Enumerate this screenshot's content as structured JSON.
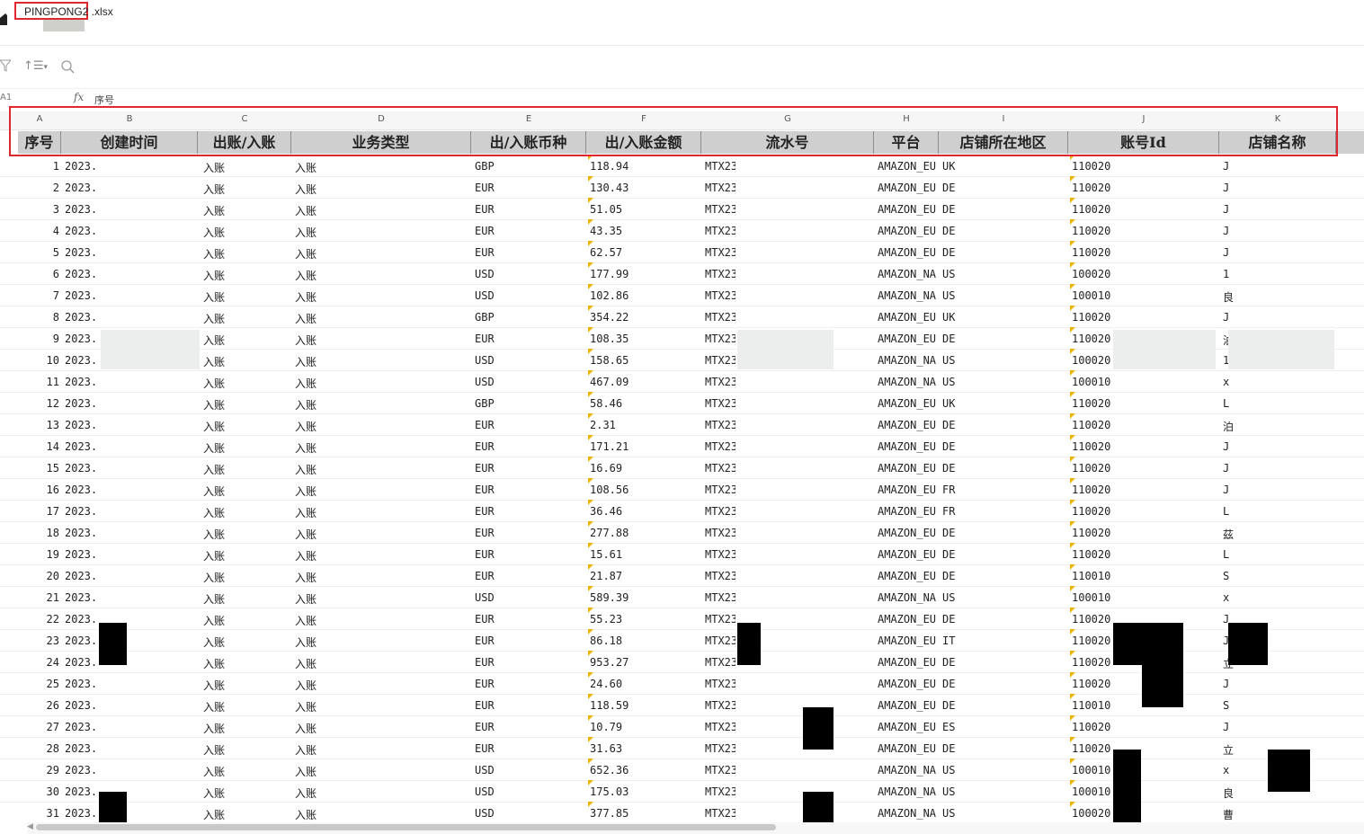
{
  "file": {
    "name_part1": "PINGPONG",
    "name_part2": "2 .xlsx"
  },
  "toolbar": {
    "filter_icon": "filter-icon",
    "sort_icon": "sort-icon",
    "search_icon": "search-icon",
    "sort_glyph": "↑☰",
    "chevron": "▾"
  },
  "formula_bar": {
    "cell_ref": "A1",
    "fx": "fx",
    "value": "序号"
  },
  "columns": {
    "letters": [
      "A",
      "B",
      "C",
      "D",
      "E",
      "F",
      "G",
      "H",
      "I",
      "J",
      "K"
    ],
    "headers": [
      "序号",
      "创建时间",
      "出账/入账",
      "业务类型",
      "出/入账币种",
      "出/入账金额",
      "流水号",
      "平台",
      "店铺所在地区",
      "账号Id",
      "店铺名称"
    ]
  },
  "rows": [
    {
      "n": "1",
      "date": "2023.(",
      "dir": "入账",
      "type": "入账",
      "cur": "GBP",
      "amt": "118.94",
      "serial": "MTX23",
      "plat": "AMAZON_EU",
      "region": "UK",
      "acct": "110020",
      "shop": "J"
    },
    {
      "n": "2",
      "date": "2023.(",
      "dir": "入账",
      "type": "入账",
      "cur": "EUR",
      "amt": "130.43",
      "serial": "MTX23",
      "plat": "AMAZON_EU",
      "region": "DE",
      "acct": "110020",
      "shop": "J"
    },
    {
      "n": "3",
      "date": "2023.(",
      "dir": "入账",
      "type": "入账",
      "cur": "EUR",
      "amt": "51.05",
      "serial": "MTX23",
      "plat": "AMAZON_EU",
      "region": "DE",
      "acct": "110020",
      "shop": "J"
    },
    {
      "n": "4",
      "date": "2023.(",
      "dir": "入账",
      "type": "入账",
      "cur": "EUR",
      "amt": "43.35",
      "serial": "MTX23",
      "plat": "AMAZON_EU",
      "region": "DE",
      "acct": "110020",
      "shop": "J"
    },
    {
      "n": "5",
      "date": "2023.(",
      "dir": "入账",
      "type": "入账",
      "cur": "EUR",
      "amt": "62.57",
      "serial": "MTX23",
      "plat": "AMAZON_EU",
      "region": "DE",
      "acct": "110020",
      "shop": "J"
    },
    {
      "n": "6",
      "date": "2023.(",
      "dir": "入账",
      "type": "入账",
      "cur": "USD",
      "amt": "177.99",
      "serial": "MTX23",
      "plat": "AMAZON_NA",
      "region": "US",
      "acct": "100020",
      "shop": "1"
    },
    {
      "n": "7",
      "date": "2023.(",
      "dir": "入账",
      "type": "入账",
      "cur": "USD",
      "amt": "102.86",
      "serial": "MTX23",
      "plat": "AMAZON_NA",
      "region": "US",
      "acct": "100010",
      "shop": "良"
    },
    {
      "n": "8",
      "date": "2023.(",
      "dir": "入账",
      "type": "入账",
      "cur": "GBP",
      "amt": "354.22",
      "serial": "MTX23",
      "plat": "AMAZON_EU",
      "region": "UK",
      "acct": "110020",
      "shop": "J"
    },
    {
      "n": "9",
      "date": "2023.(",
      "dir": "入账",
      "type": "入账",
      "cur": "EUR",
      "amt": "108.35",
      "serial": "MTX23",
      "plat": "AMAZON_EU",
      "region": "DE",
      "acct": "110020",
      "shop": "泊"
    },
    {
      "n": "10",
      "date": "2023.(",
      "dir": "入账",
      "type": "入账",
      "cur": "USD",
      "amt": "158.65",
      "serial": "MTX23",
      "plat": "AMAZON_NA",
      "region": "US",
      "acct": "100020",
      "shop": "1"
    },
    {
      "n": "11",
      "date": "2023.(",
      "dir": "入账",
      "type": "入账",
      "cur": "USD",
      "amt": "467.09",
      "serial": "MTX23",
      "plat": "AMAZON_NA",
      "region": "US",
      "acct": "100010",
      "shop": "x"
    },
    {
      "n": "12",
      "date": "2023.(",
      "dir": "入账",
      "type": "入账",
      "cur": "GBP",
      "amt": "58.46",
      "serial": "MTX23",
      "plat": "AMAZON_EU",
      "region": "UK",
      "acct": "110020",
      "shop": "L"
    },
    {
      "n": "13",
      "date": "2023.(",
      "dir": "入账",
      "type": "入账",
      "cur": "EUR",
      "amt": "2.31",
      "serial": "MTX23",
      "plat": "AMAZON_EU",
      "region": "DE",
      "acct": "110020",
      "shop": "泊"
    },
    {
      "n": "14",
      "date": "2023.(",
      "dir": "入账",
      "type": "入账",
      "cur": "EUR",
      "amt": "171.21",
      "serial": "MTX23",
      "plat": "AMAZON_EU",
      "region": "DE",
      "acct": "110020",
      "shop": "J"
    },
    {
      "n": "15",
      "date": "2023.(",
      "dir": "入账",
      "type": "入账",
      "cur": "EUR",
      "amt": "16.69",
      "serial": "MTX23",
      "plat": "AMAZON_EU",
      "region": "DE",
      "acct": "110020",
      "shop": "J"
    },
    {
      "n": "16",
      "date": "2023.(",
      "dir": "入账",
      "type": "入账",
      "cur": "EUR",
      "amt": "108.56",
      "serial": "MTX23",
      "plat": "AMAZON_EU",
      "region": "FR",
      "acct": "110020",
      "shop": "J"
    },
    {
      "n": "17",
      "date": "2023.(",
      "dir": "入账",
      "type": "入账",
      "cur": "EUR",
      "amt": "36.46",
      "serial": "MTX23",
      "plat": "AMAZON_EU",
      "region": "FR",
      "acct": "110020",
      "shop": "L"
    },
    {
      "n": "18",
      "date": "2023.(",
      "dir": "入账",
      "type": "入账",
      "cur": "EUR",
      "amt": "277.88",
      "serial": "MTX23",
      "plat": "AMAZON_EU",
      "region": "DE",
      "acct": "110020",
      "shop": "茲"
    },
    {
      "n": "19",
      "date": "2023.(",
      "dir": "入账",
      "type": "入账",
      "cur": "EUR",
      "amt": "15.61",
      "serial": "MTX23",
      "plat": "AMAZON_EU",
      "region": "DE",
      "acct": "110020",
      "shop": "L"
    },
    {
      "n": "20",
      "date": "2023.(",
      "dir": "入账",
      "type": "入账",
      "cur": "EUR",
      "amt": "21.87",
      "serial": "MTX23",
      "plat": "AMAZON_EU",
      "region": "DE",
      "acct": "110010",
      "shop": "S"
    },
    {
      "n": "21",
      "date": "2023.(",
      "dir": "入账",
      "type": "入账",
      "cur": "USD",
      "amt": "589.39",
      "serial": "MTX23",
      "plat": "AMAZON_NA",
      "region": "US",
      "acct": "100010",
      "shop": "x"
    },
    {
      "n": "22",
      "date": "2023.(",
      "dir": "入账",
      "type": "入账",
      "cur": "EUR",
      "amt": "55.23",
      "serial": "MTX23",
      "plat": "AMAZON_EU",
      "region": "DE",
      "acct": "110020",
      "shop": "J"
    },
    {
      "n": "23",
      "date": "2023.(",
      "dir": "入账",
      "type": "入账",
      "cur": "EUR",
      "amt": "86.18",
      "serial": "MTX23",
      "plat": "AMAZON_EU",
      "region": "IT",
      "acct": "110020",
      "shop": "J"
    },
    {
      "n": "24",
      "date": "2023.(",
      "dir": "入账",
      "type": "入账",
      "cur": "EUR",
      "amt": "953.27",
      "serial": "MTX23",
      "plat": "AMAZON_EU",
      "region": "DE",
      "acct": "110020",
      "shop": "立"
    },
    {
      "n": "25",
      "date": "2023.(",
      "dir": "入账",
      "type": "入账",
      "cur": "EUR",
      "amt": "24.60",
      "serial": "MTX23",
      "plat": "AMAZON_EU",
      "region": "DE",
      "acct": "110020",
      "shop": "J"
    },
    {
      "n": "26",
      "date": "2023.(",
      "dir": "入账",
      "type": "入账",
      "cur": "EUR",
      "amt": "118.59",
      "serial": "MTX23",
      "plat": "AMAZON_EU",
      "region": "DE",
      "acct": "110010",
      "shop": "S"
    },
    {
      "n": "27",
      "date": "2023.(",
      "dir": "入账",
      "type": "入账",
      "cur": "EUR",
      "amt": "10.79",
      "serial": "MTX23",
      "plat": "AMAZON_EU",
      "region": "ES",
      "acct": "110020",
      "shop": "J"
    },
    {
      "n": "28",
      "date": "2023.(",
      "dir": "入账",
      "type": "入账",
      "cur": "EUR",
      "amt": "31.63",
      "serial": "MTX23",
      "plat": "AMAZON_EU",
      "region": "DE",
      "acct": "110020",
      "shop": "立"
    },
    {
      "n": "29",
      "date": "2023.(",
      "dir": "入账",
      "type": "入账",
      "cur": "USD",
      "amt": "652.36",
      "serial": "MTX23",
      "plat": "AMAZON_NA",
      "region": "US",
      "acct": "100010",
      "shop": "x"
    },
    {
      "n": "30",
      "date": "2023.(",
      "dir": "入账",
      "type": "入账",
      "cur": "USD",
      "amt": "175.03",
      "serial": "MTX23",
      "plat": "AMAZON_NA",
      "region": "US",
      "acct": "100010",
      "shop": "良"
    },
    {
      "n": "31",
      "date": "2023.(",
      "dir": "入账",
      "type": "入账",
      "cur": "USD",
      "amt": "377.85",
      "serial": "MTX23",
      "plat": "AMAZON_NA",
      "region": "US",
      "acct": "100020",
      "shop": "曹"
    }
  ],
  "colors": {
    "header_bg": "#cfcfcf",
    "highlight": "#e0272f",
    "triangle": "#f0b400"
  }
}
